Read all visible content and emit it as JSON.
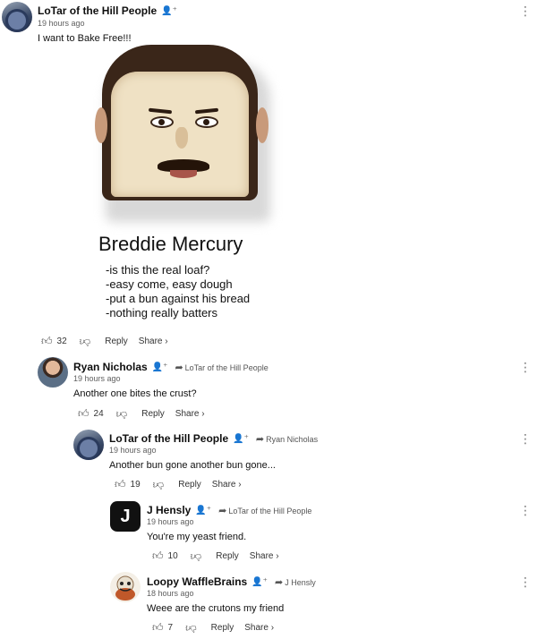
{
  "comments": [
    {
      "author": "LoTar of the Hill People",
      "time": "19 hours ago",
      "text": "I want to Bake Free!!!",
      "likes": "32",
      "reply_label": "Reply",
      "share_label": "Share ›"
    },
    {
      "author": "Ryan Nicholas",
      "reply_to": "LoTar of the Hill People",
      "time": "19 hours ago",
      "text": "Another one bites the crust?",
      "likes": "24",
      "reply_label": "Reply",
      "share_label": "Share ›"
    },
    {
      "author": "LoTar of the Hill People",
      "reply_to": "Ryan Nicholas",
      "time": "19 hours ago",
      "text": "Another bun gone another bun gone...",
      "likes": "19",
      "reply_label": "Reply",
      "share_label": "Share ›"
    },
    {
      "author": "J Hensly",
      "avatar_letter": "J",
      "reply_to": "LoTar of the Hill People",
      "time": "19 hours ago",
      "text": "You're my yeast friend.",
      "likes": "10",
      "reply_label": "Reply",
      "share_label": "Share ›"
    },
    {
      "author": "Loopy WaffleBrains",
      "reply_to": "J Hensly",
      "time": "18 hours ago",
      "text": "Weee are the crutons my friend",
      "likes": "7",
      "reply_label": "Reply",
      "share_label": "Share ›"
    }
  ],
  "meme": {
    "title": "Breddie Mercury",
    "lines": [
      "-is this the real loaf?",
      "-easy come, easy dough",
      "-put a bun against his bread",
      "-nothing really batters"
    ]
  },
  "icons": {
    "badge": "person-plus-icon",
    "like": "thumbs-up-icon",
    "dislike": "thumbs-down-icon",
    "menu": "more-vert-icon",
    "reply_arrow": "reply-arrow-icon"
  },
  "colors": {
    "background": "#ffffff",
    "text": "#111111",
    "muted": "#606060"
  }
}
